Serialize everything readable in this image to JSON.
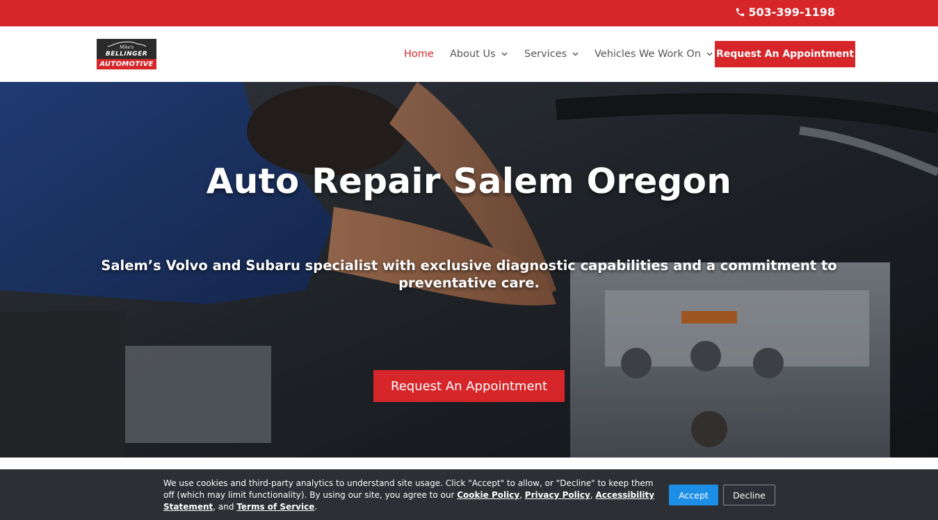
{
  "topbar": {
    "phone_icon": "phone-icon",
    "phone": "503-399-1198",
    "color": "#d6262a"
  },
  "logo": {
    "script": "Mike's",
    "name": "BELLINGER",
    "sub": "AUTOMOTIVE"
  },
  "nav": {
    "items": [
      {
        "label": "Home",
        "active": true,
        "dropdown": false
      },
      {
        "label": "About Us",
        "active": false,
        "dropdown": true
      },
      {
        "label": "Services",
        "active": false,
        "dropdown": true
      },
      {
        "label": "Vehicles We Work On",
        "active": false,
        "dropdown": true
      }
    ],
    "cta": "Request An Appointment"
  },
  "hero": {
    "title": "Auto Repair Salem Oregon",
    "subtitle": "Salem’s Volvo and Subaru specialist with exclusive diagnostic capabilities and a commitment to preventative care.",
    "button": "Request An Appointment"
  },
  "cookie": {
    "text_before": "We use cookies and third-party analytics to understand site usage. Click \"Accept\" to allow, or \"Decline\" to keep them off (which may limit functionality). By using our site, you agree to our ",
    "link_cookie": "Cookie Policy",
    "sep1": ", ",
    "link_privacy": "Privacy Policy",
    "sep2": ", ",
    "link_access": "Accessibility Statement",
    "sep3": ", and ",
    "link_terms": "Terms of Service",
    "end": ".",
    "accept": "Accept",
    "decline": "Decline"
  }
}
